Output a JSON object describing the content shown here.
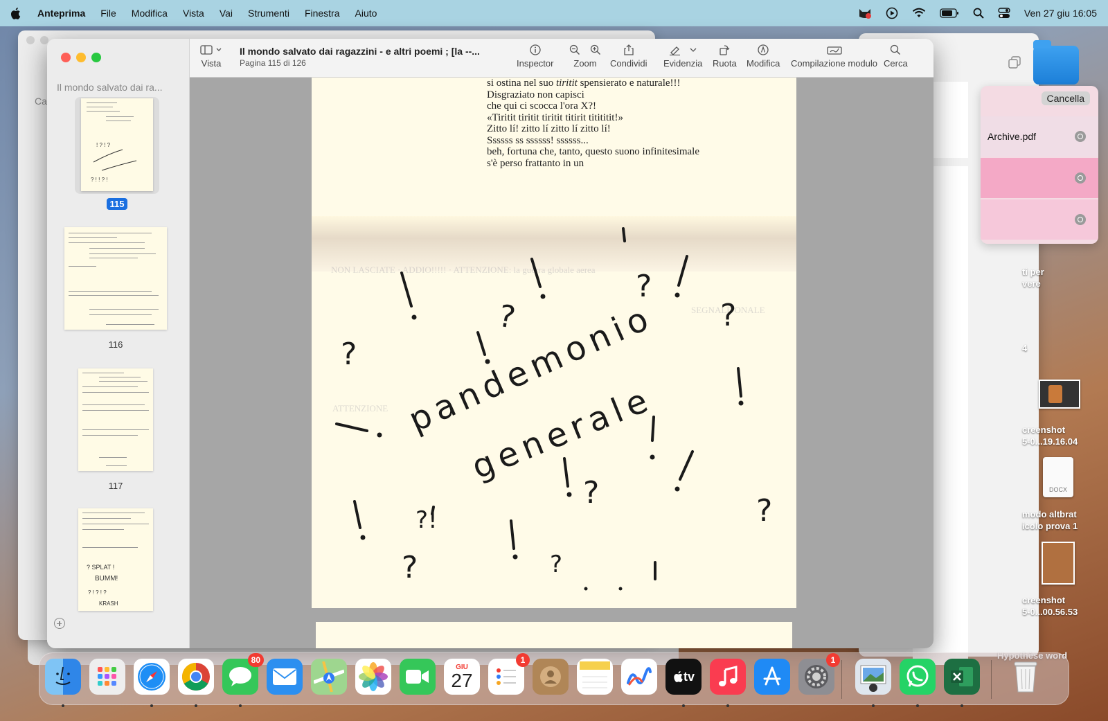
{
  "menubar": {
    "app_name": "Anteprima",
    "menus": [
      "File",
      "Modifica",
      "Vista",
      "Vai",
      "Strumenti",
      "Finestra",
      "Aiuto"
    ],
    "clock": "Ven 27 giu  16:05"
  },
  "window": {
    "title": "Il mondo salvato dai ragazzini - e altri poemi ; [la --...",
    "subtitle": "Pagina 115 di 126",
    "sidebar_title": "Il mondo salvato dai ra...",
    "background_window_label": "Ca",
    "toolbar": {
      "view_label": "Vista",
      "inspector_label": "Inspector",
      "zoom_label": "Zoom",
      "share_label": "Condividi",
      "highlight_label": "Evidenzia",
      "rotate_label": "Ruota",
      "markup_label": "Modifica",
      "form_label": "Compilazione modulo",
      "search_label": "Cerca"
    },
    "thumbnails": [
      {
        "page": "115",
        "selected": true
      },
      {
        "page": "116",
        "selected": false
      },
      {
        "page": "117",
        "selected": false
      },
      {
        "page": "",
        "selected": false
      }
    ]
  },
  "document": {
    "poem_lines": [
      {
        "pre": "si ostina nel suo ",
        "italic": "tiritit",
        "post": " spensierato e naturale!!!"
      },
      {
        "pre": "Disgraziato non capisci",
        "italic": "",
        "post": ""
      },
      {
        "pre": "che qui ci scocca l'ora X?!",
        "italic": "",
        "post": ""
      },
      {
        "pre": "«Tiritit tiritit tiritit titirit titititit!»",
        "italic": "",
        "post": ""
      },
      {
        "pre": "Zitto lí! zitto lí zitto lí zitto lí!",
        "italic": "",
        "post": ""
      },
      {
        "pre": "Ssssss ss ssssss! ssssss...",
        "italic": "",
        "post": ""
      },
      {
        "pre": "beh, fortuna che, tanto, questo suono infinitesimale",
        "italic": "",
        "post": ""
      },
      {
        "pre": "s'è perso frattanto in un",
        "italic": "",
        "post": ""
      }
    ],
    "handwriting_line1": "pandemonio",
    "handwriting_line2": "generale",
    "ghost_texts": [
      "NON LASCIATE · ADDIO!!!!! · ATTENZIONE: la guerra globale aerea",
      "SEGNALE ONALE",
      "ATTENZIONE"
    ]
  },
  "side_panel": {
    "cancel_label": "Cancella",
    "files": [
      "Archive.pdf",
      "",
      ""
    ]
  },
  "desktop": {
    "labels": [
      "ti per\nvere",
      "4",
      "creenshot\n5-0...19.16.04",
      "modo altbrat\nicolo prova 1",
      "creenshot\n5-0...00.56.53",
      "Hypothèse word"
    ],
    "docx_label": "DOCX"
  },
  "dock": {
    "apps": [
      {
        "name": "Finder",
        "badge": ""
      },
      {
        "name": "Launchpad",
        "badge": ""
      },
      {
        "name": "Safari",
        "badge": ""
      },
      {
        "name": "Chrome",
        "badge": ""
      },
      {
        "name": "Messaggi",
        "badge": "80"
      },
      {
        "name": "Mail",
        "badge": ""
      },
      {
        "name": "Mappe",
        "badge": ""
      },
      {
        "name": "Foto",
        "badge": ""
      },
      {
        "name": "FaceTime",
        "badge": ""
      },
      {
        "name": "Calendario",
        "badge": ""
      },
      {
        "name": "Promemoria",
        "badge": "1"
      },
      {
        "name": "Contatti",
        "badge": ""
      },
      {
        "name": "Note",
        "badge": ""
      },
      {
        "name": "Freeform",
        "badge": ""
      },
      {
        "name": "TV",
        "badge": ""
      },
      {
        "name": "Musica",
        "badge": ""
      },
      {
        "name": "App Store",
        "badge": ""
      },
      {
        "name": "Impostazioni di Sistema",
        "badge": "1"
      },
      {
        "name": "Anteprima",
        "badge": ""
      },
      {
        "name": "WhatsApp",
        "badge": ""
      },
      {
        "name": "Excel",
        "badge": ""
      },
      {
        "name": "Cestino",
        "badge": ""
      }
    ],
    "calendar_month": "GIU",
    "calendar_day": "27",
    "tv_label": "tv"
  },
  "colors": {
    "menubar_bg": "#a9d3e2",
    "selection_blue": "#1a6fe0",
    "paper": "#fffbe8",
    "badge_red": "#f23b32"
  }
}
